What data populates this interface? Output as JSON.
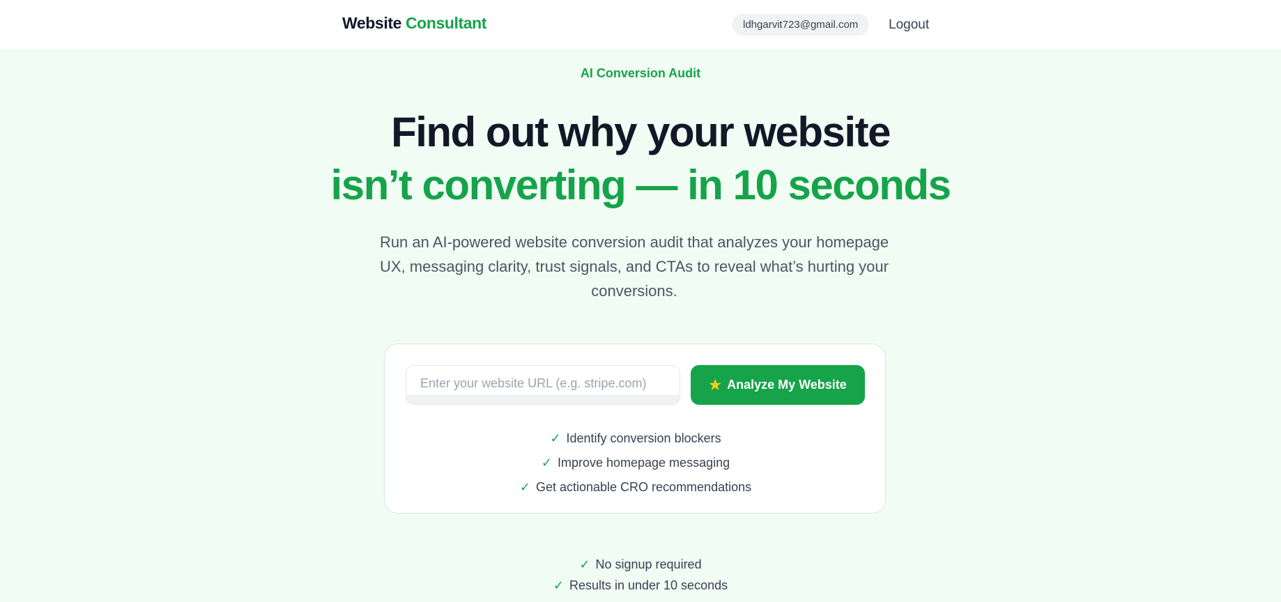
{
  "header": {
    "brand_primary": "Website",
    "brand_accent": "Consultant",
    "user_email": "ldhgarvit723@gmail.com",
    "logout_label": "Logout"
  },
  "hero": {
    "eyebrow": "AI Conversion Audit",
    "headline_line1": "Find out why your website",
    "headline_line2": "isn’t converting — in 10 seconds",
    "subtitle": "Run an AI-powered website conversion audit that analyzes your homepage UX, messaging clarity, trust signals, and CTAs to reveal what’s hurting your conversions."
  },
  "audit_form": {
    "url_placeholder": "Enter your website URL (e.g. stripe.com)",
    "url_value": "",
    "analyze_label": "Analyze My Website",
    "analyze_icon": "star-icon",
    "features": [
      "Identify conversion blockers",
      "Improve homepage messaging",
      "Get actionable CRO recommendations"
    ]
  },
  "benefits": [
    "No signup required",
    "Results in under 10 seconds"
  ],
  "icons": {
    "check": "✓",
    "star": "★"
  },
  "colors": {
    "accent": "#16a34a",
    "background": "#f1fcf4",
    "heading": "#111827",
    "star": "#facc15"
  }
}
